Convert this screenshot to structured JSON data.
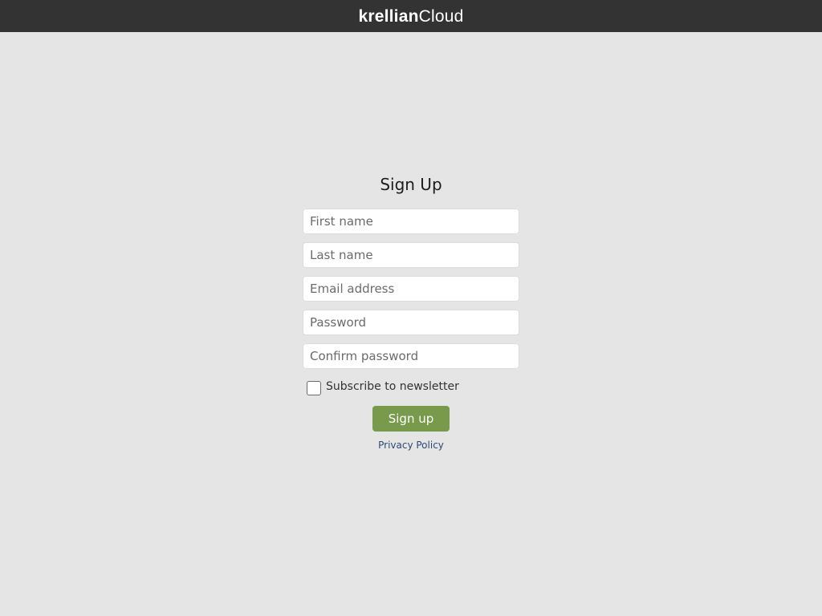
{
  "header": {
    "logo_bold": "krellian",
    "logo_light": "Cloud"
  },
  "form": {
    "title": "Sign Up",
    "first_name": {
      "placeholder": "First name",
      "value": ""
    },
    "last_name": {
      "placeholder": "Last name",
      "value": ""
    },
    "email": {
      "placeholder": "Email address",
      "value": ""
    },
    "password": {
      "placeholder": "Password",
      "value": ""
    },
    "confirm_password": {
      "placeholder": "Confirm password",
      "value": ""
    },
    "newsletter_label": "Subscribe to newsletter",
    "newsletter_checked": false,
    "submit_label": "Sign up",
    "privacy_link": "Privacy Policy"
  },
  "colors": {
    "header_bg": "#333333",
    "page_bg": "#e5e5e5",
    "button_bg": "#779a4b",
    "link": "#2c4a74"
  }
}
